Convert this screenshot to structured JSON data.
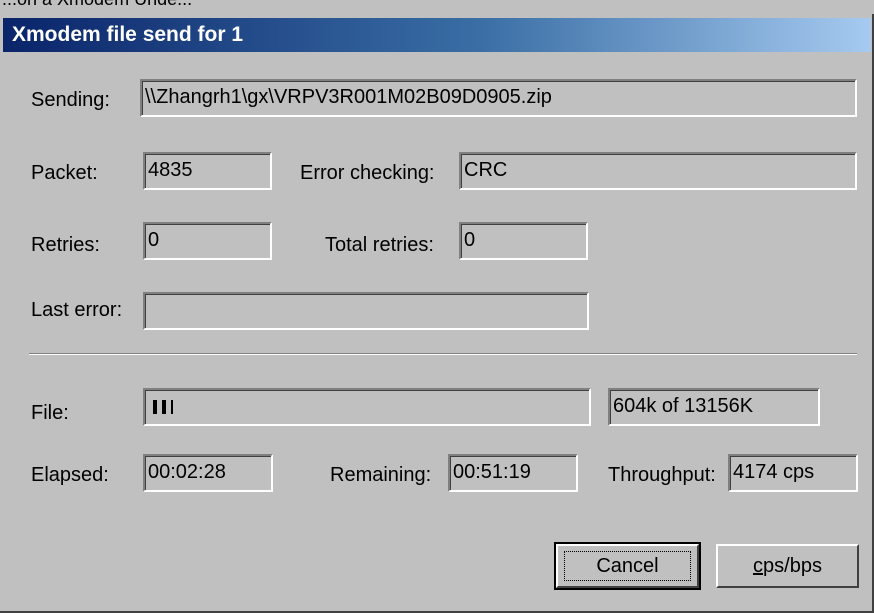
{
  "background_window": {
    "partial_title": "...on a Xmodem Unde..."
  },
  "dialog": {
    "title": "Xmodem file send for 1",
    "sending": {
      "label": "Sending:",
      "value": "\\\\Zhangrh1\\gx\\VRPV3R001M02B09D0905.zip"
    },
    "packet": {
      "label": "Packet:",
      "value": "4835"
    },
    "error_checking": {
      "label": "Error checking:",
      "value": "CRC"
    },
    "retries": {
      "label": "Retries:",
      "value": "0"
    },
    "total_retries": {
      "label": "Total retries:",
      "value": "0"
    },
    "last_error": {
      "label": "Last error:",
      "value": ""
    },
    "file": {
      "label": "File:",
      "progress_fraction": 0.046,
      "summary": "604k of 13156K"
    },
    "elapsed": {
      "label": "Elapsed:",
      "value": "00:02:28"
    },
    "remaining": {
      "label": "Remaining:",
      "value": "00:51:19"
    },
    "throughput": {
      "label": "Throughput:",
      "value": "4174 cps"
    },
    "buttons": {
      "cancel": "Cancel",
      "cps_bps_mnemonic": "c",
      "cps_bps_rest": "ps/bps"
    }
  },
  "colors": {
    "face": "#c0c0c0",
    "title_start": "#0a246a",
    "title_end": "#a6caf0"
  }
}
